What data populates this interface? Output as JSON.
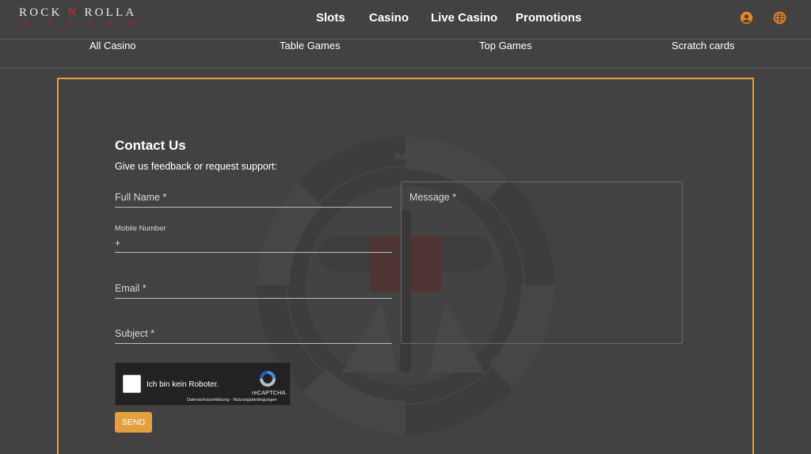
{
  "brand": {
    "line1_a": "ROCK",
    "line1_n": "N",
    "line1_b": "ROLLA",
    "line2": "CASINO"
  },
  "main_nav": [
    "Slots",
    "Casino",
    "Live Casino",
    "Promotions"
  ],
  "sub_nav": [
    "All Casino",
    "Table Games",
    "Top Games",
    "Scratch cards"
  ],
  "header_icons": [
    "user-icon",
    "globe-icon"
  ],
  "colors": {
    "accent": "#e4a03c",
    "background": "#424242",
    "logo_red": "#d0202a"
  },
  "contact": {
    "title": "Contact Us",
    "subtitle": "Give us feedback or request support:",
    "full_name_label": "Full Name *",
    "mobile_label": "Mobile Number",
    "mobile_prefix": "+",
    "email_label": "Email *",
    "subject_label": "Subject *",
    "message_label": "Message *",
    "send_label": "SEND"
  },
  "captcha": {
    "text": "Ich bin kein Roboter.",
    "brand": "reCAPTCHA",
    "legal": "Datenschutzerklärung - Nutzungsbedingungen"
  }
}
